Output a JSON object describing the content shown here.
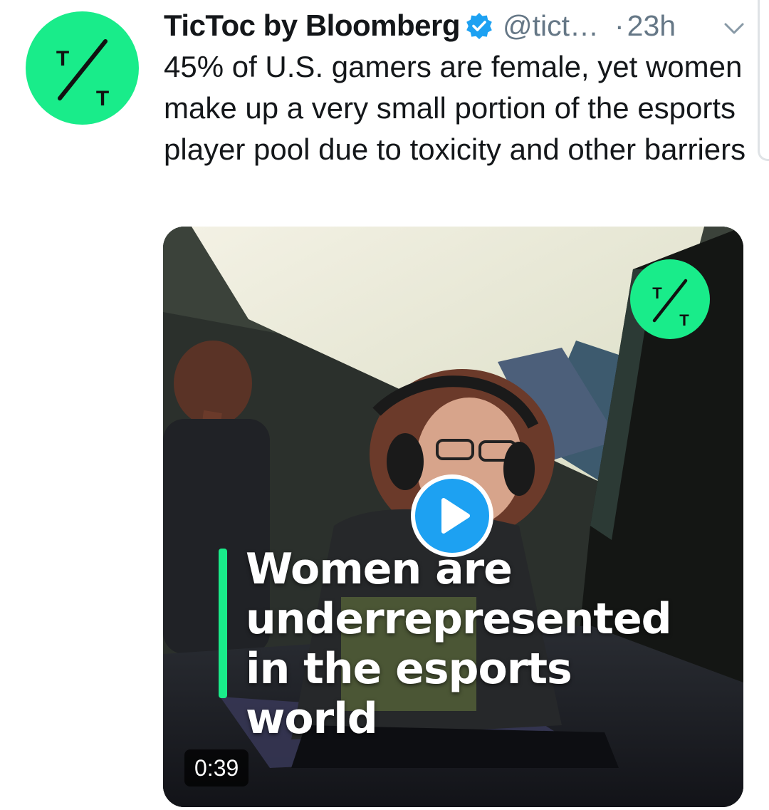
{
  "tweet": {
    "author_name": "TicToc by Bloomberg",
    "handle": "@tict…",
    "separator": "·",
    "time_ago": "23h",
    "text": "45% of U.S. gamers are female, yet women make up a very small portion of the esports player pool due to toxicity and other barriers"
  },
  "media": {
    "caption": "Women are underrepresented in the esports world",
    "duration": "0:39"
  },
  "colors": {
    "brand_green": "#19ec8a",
    "play_blue": "#1da1f2",
    "verified_blue": "#1da1f2",
    "secondary_text": "#657786"
  },
  "icons": {
    "avatar": "tictoc-logo-icon",
    "verified": "verified-badge-icon",
    "menu": "chevron-down-icon",
    "play": "play-icon"
  }
}
